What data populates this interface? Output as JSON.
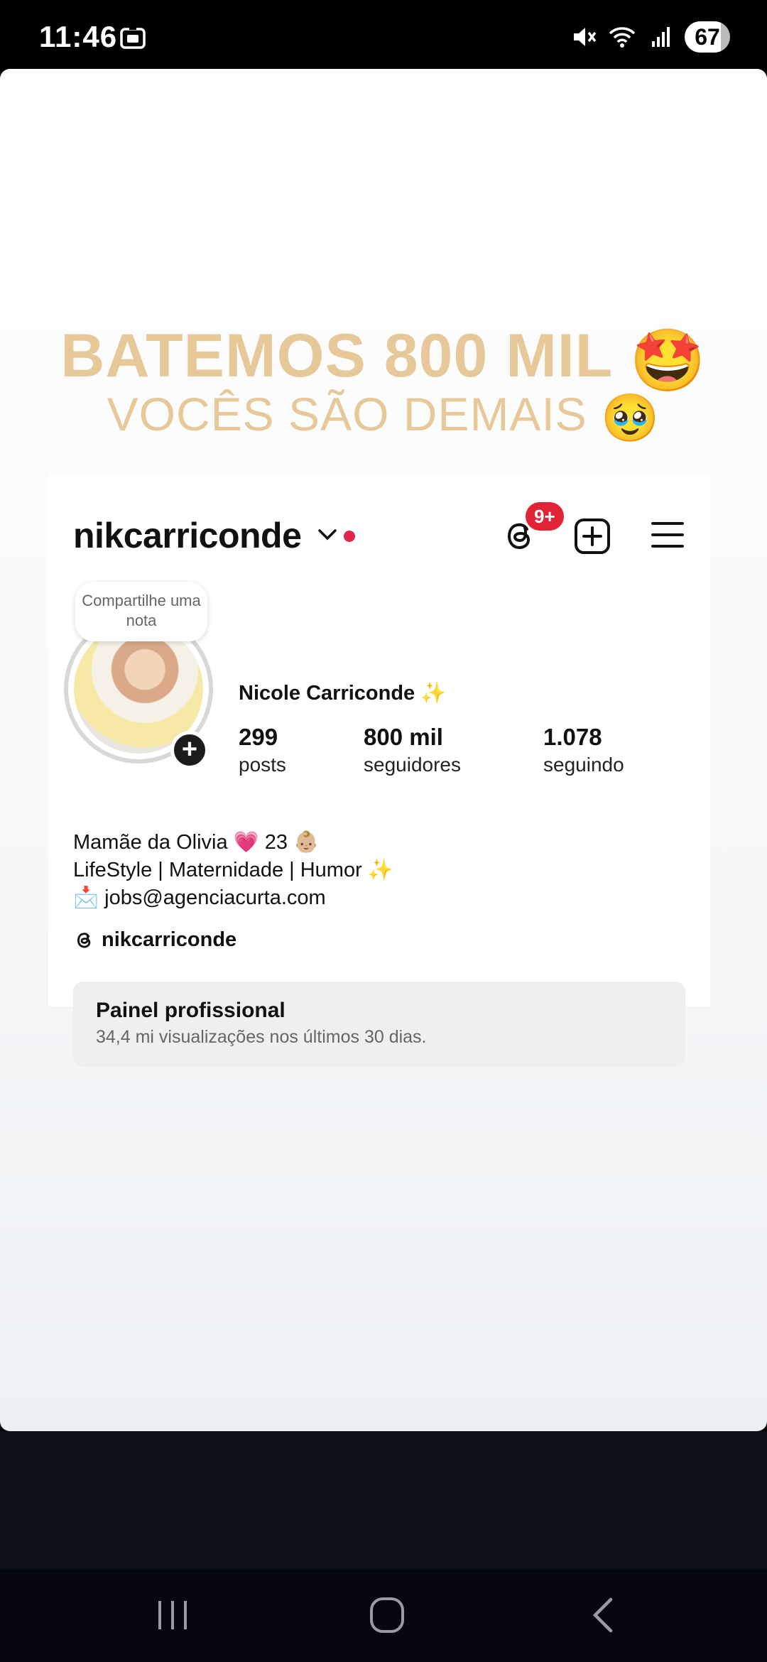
{
  "status_bar": {
    "time": "11:46",
    "battery": "67",
    "icons": [
      "screenshot-icon",
      "mute-icon",
      "wifi-icon",
      "signal-icon",
      "battery-icon"
    ]
  },
  "story": {
    "headline_1": "BATEMOS 800 MIL",
    "headline_1_emoji": "🤩",
    "headline_2": "VOCÊS SÃO DEMAIS",
    "headline_2_emoji": "🥹",
    "text_color": "#e7c899"
  },
  "profile": {
    "username": "nikcarriconde",
    "notification_badge": "9+",
    "note_bubble": "Compartilhe uma nota",
    "display_name": "Nicole Carriconde ✨",
    "stats": [
      {
        "value": "299",
        "label": "posts"
      },
      {
        "value": "800 mil",
        "label": "seguidores"
      },
      {
        "value": "1.078",
        "label": "seguindo"
      }
    ],
    "bio": [
      "Mamãe da Olivia 💗 23 👶🏼",
      "LifeStyle | Maternidade | Humor ✨",
      "📩 jobs@agenciacurta.com"
    ],
    "threads_handle": "nikcarriconde",
    "pro_panel": {
      "title": "Painel profissional",
      "subtitle": "34,4 mi visualizações nos últimos 30 dias."
    }
  },
  "nav_bar": {
    "buttons": [
      "recents-icon",
      "home-icon",
      "back-icon"
    ]
  }
}
